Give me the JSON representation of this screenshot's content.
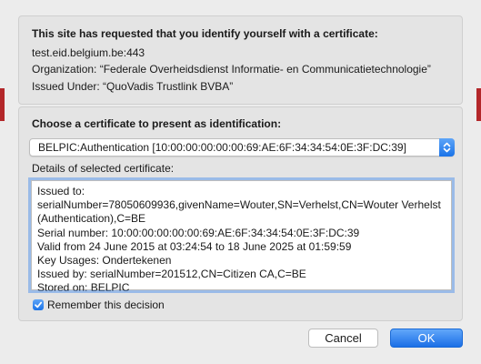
{
  "site_box": {
    "heading": "This site has requested that you identify yourself with a certificate:",
    "host": "test.eid.belgium.be:443",
    "organization": "Organization: “Federale Overheidsdienst Informatie- en Communicatietechnologie”",
    "issued_under": "Issued Under: “QuoVadis Trustlink BVBA”"
  },
  "cert_box": {
    "heading": "Choose a certificate to present as identification:",
    "selected_certificate": "BELPIC:Authentication [10:00:00:00:00:00:69:AE:6F:34:34:54:0E:3F:DC:39]",
    "details_label": "Details of selected certificate:",
    "details": {
      "issued_to": "Issued to: serialNumber=78050609936,givenName=Wouter,SN=Verhelst,CN=Wouter Verhelst (Authentication),C=BE",
      "serial": "Serial number: 10:00:00:00:00:00:69:AE:6F:34:34:54:0E:3F:DC:39",
      "valid": "Valid from 24 June 2015 at 03:24:54 to 18 June 2025 at 01:59:59",
      "key_usages": "Key Usages: Ondertekenen",
      "issued_by": "Issued by: serialNumber=201512,CN=Citizen CA,C=BE",
      "stored_on": "Stored on: BELPIC"
    },
    "remember_label": "Remember this decision",
    "remember_checked": true
  },
  "buttons": {
    "cancel": "Cancel",
    "ok": "OK"
  },
  "colors": {
    "accent": "#1a73e8",
    "background": "#ececec",
    "edge": "#b3272a"
  },
  "icons": {
    "stepper": "chevron-up-down-icon",
    "checkbox": "checkmark-icon"
  }
}
